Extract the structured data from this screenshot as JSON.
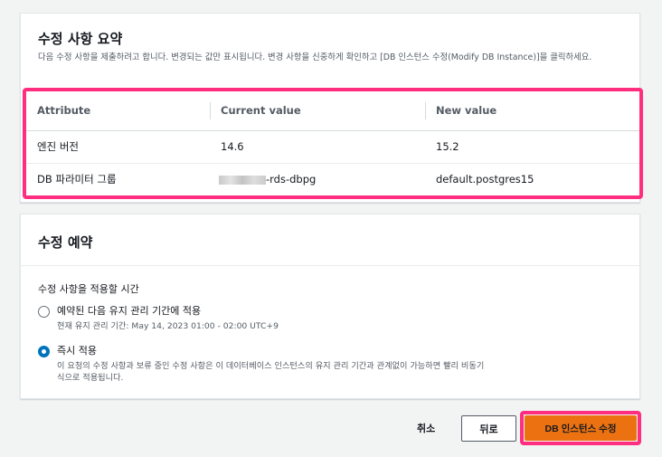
{
  "summary": {
    "title": "수정 사항 요약",
    "description": "다음 수정 사항을 제출하려고 합니다. 변경되는 값만 표시됩니다. 변경 사항을 신중하게 확인하고 [DB 인스턴스 수정(Modify DB Instance)]을 클릭하세요."
  },
  "table": {
    "headers": [
      "Attribute",
      "Current value",
      "New value"
    ],
    "rows": [
      {
        "attribute": "엔진 버전",
        "current": "14.6",
        "new": "15.2"
      },
      {
        "attribute": "DB 파라미터 그룹",
        "current": "-rds-dbpg",
        "new": "default.postgres15"
      }
    ]
  },
  "schedule": {
    "title": "수정 예약",
    "field_label": "수정 사항을 적용할 시간",
    "options": [
      {
        "label": "예약된 다음 유지 관리 기간에 적용",
        "description": "현재 유지 관리 기간: May 14, 2023 01:00 - 02:00 UTC+9",
        "selected": false
      },
      {
        "label": "즉시 적용",
        "description": "이 요청의 수정 사항과 보류 중인 수정 사항은 이 데이터베이스 인스턴스의 유지 관리 기간과 관계없이 가능하면 빨리 비동기식으로 적용됩니다.",
        "selected": true
      }
    ]
  },
  "footer": {
    "cancel_label": "취소",
    "back_label": "뒤로",
    "submit_label": "DB 인스턴스 수정"
  },
  "colors": {
    "highlight": "#ff2e7e",
    "primary_button": "#ec7211",
    "radio_selected": "#0073bb"
  }
}
